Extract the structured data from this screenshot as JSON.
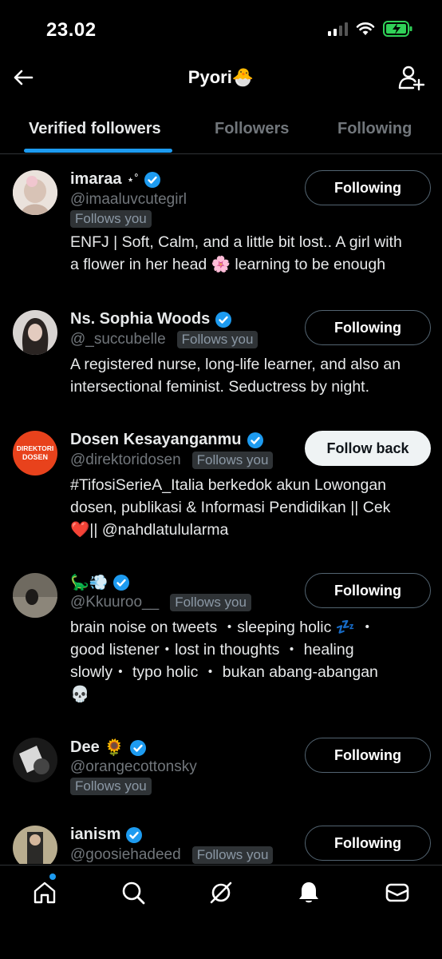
{
  "status": {
    "time": "23.02"
  },
  "header": {
    "title": "Pyori",
    "title_emoji": "🐣"
  },
  "tabs": [
    {
      "label": "Verified followers",
      "active": true
    },
    {
      "label": "Followers",
      "active": false
    },
    {
      "label": "Following",
      "active": false
    }
  ],
  "follows_you_label": "Follows you",
  "users": [
    {
      "name": "imaraa",
      "name_suffix": "⋆˚",
      "handle": "@imaaluvcutegirl",
      "follows_you": true,
      "button": "Following",
      "bio": [
        "ENFJ | Soft, Calm, and a little bit lost.. A girl with",
        "a flower in her head 🌸 learning to be enough"
      ]
    },
    {
      "name": "Ns. Sophia Woods",
      "name_suffix": "",
      "handle": "@_succubelle",
      "follows_you": true,
      "button": "Following",
      "bio": [
        "A registered nurse, long-life learner, and also an",
        "intersectional feminist. Seductress by night."
      ]
    },
    {
      "name": "Dosen Kesayanganmu",
      "name_suffix": "",
      "handle": "@direktoridosen",
      "follows_you": true,
      "button": "Follow back",
      "avatar_text": [
        "DIREKTORI",
        "DOSEN"
      ],
      "bio": [
        "#TifosiSerieA_Italia berkedok akun Lowongan",
        "dosen, publikasi & Informasi Pendidikan || Cek",
        "❤️|| @nahdlatulularma"
      ]
    },
    {
      "name": "🦕💨",
      "name_suffix": "",
      "handle": "@Kkuuroo__",
      "follows_you": true,
      "button": "Following",
      "bio": [
        "brain noise on tweets ・sleeping holic 💤 ・",
        "good listener・lost in thoughts ・ healing",
        "slowly・ typo holic ・ bukan abang-abangan",
        "💀"
      ]
    },
    {
      "name": "Dee",
      "name_suffix": "🌻",
      "handle": "@orangecottonsky",
      "follows_you": true,
      "button": "Following",
      "bio": []
    },
    {
      "name": "ianism",
      "name_suffix": "",
      "handle": "@goosiehadeed",
      "follows_you": true,
      "button": "Following",
      "bio": []
    }
  ],
  "nav": [
    "home-icon",
    "search-icon",
    "grok-icon",
    "notifications-icon",
    "messages-icon"
  ],
  "colors": {
    "accent": "#1d9bf0",
    "background": "#000000",
    "muted": "#71767b"
  }
}
